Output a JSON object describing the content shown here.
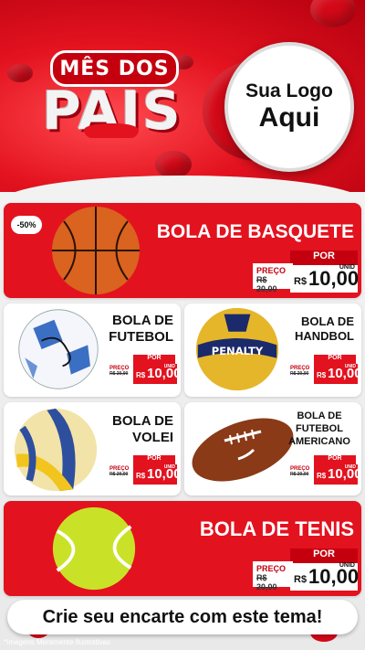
{
  "header": {
    "title_line1": "MÊS DOS",
    "title_line2": "PAIS",
    "logo_line1": "Sua Logo",
    "logo_line2": "Aqui"
  },
  "products": [
    {
      "name": "BOLA DE BASQUETE",
      "discount": "-50%",
      "price_label": "PREÇO",
      "old_price": "R$ 20,00",
      "por": "POR",
      "currency": "R$",
      "price": "10,00",
      "unit": "UNID"
    },
    {
      "name_lines": [
        "BOLA DE",
        "FUTEBOL"
      ],
      "price_label": "PREÇO",
      "old_price": "R$ 20,00",
      "por": "POR",
      "currency": "R$",
      "price": "10,00",
      "unit": "UNID"
    },
    {
      "name_lines": [
        "BOLA DE",
        "HANDBOL"
      ],
      "price_label": "PREÇO",
      "old_price": "R$ 20,00",
      "por": "POR",
      "currency": "R$",
      "price": "10,00",
      "unit": "UNID"
    },
    {
      "name_lines": [
        "BOLA DE",
        "VOLEI"
      ],
      "price_label": "PREÇO",
      "old_price": "R$ 20,00",
      "por": "POR",
      "currency": "R$",
      "price": "10,00",
      "unit": "UNID"
    },
    {
      "name_lines": [
        "BOLA DE",
        "FUTEBOL",
        "AMERICANO"
      ],
      "price_label": "PREÇO",
      "old_price": "R$ 20,00",
      "por": "POR",
      "currency": "R$",
      "price": "10,00",
      "unit": "UNID"
    },
    {
      "name": "BOLA DE TENIS",
      "price_label": "PREÇO",
      "old_price": "R$ 20,00",
      "por": "POR",
      "currency": "R$",
      "price": "10,00",
      "unit": "UNID"
    }
  ],
  "footer": {
    "cta": "Crie seu encarte com este tema!",
    "note": "*Imagens Meramente Ilustrativas"
  },
  "colors": {
    "brand_red": "#e3121f",
    "dark_red": "#c4000f",
    "light_bg": "#f2f2f2"
  }
}
